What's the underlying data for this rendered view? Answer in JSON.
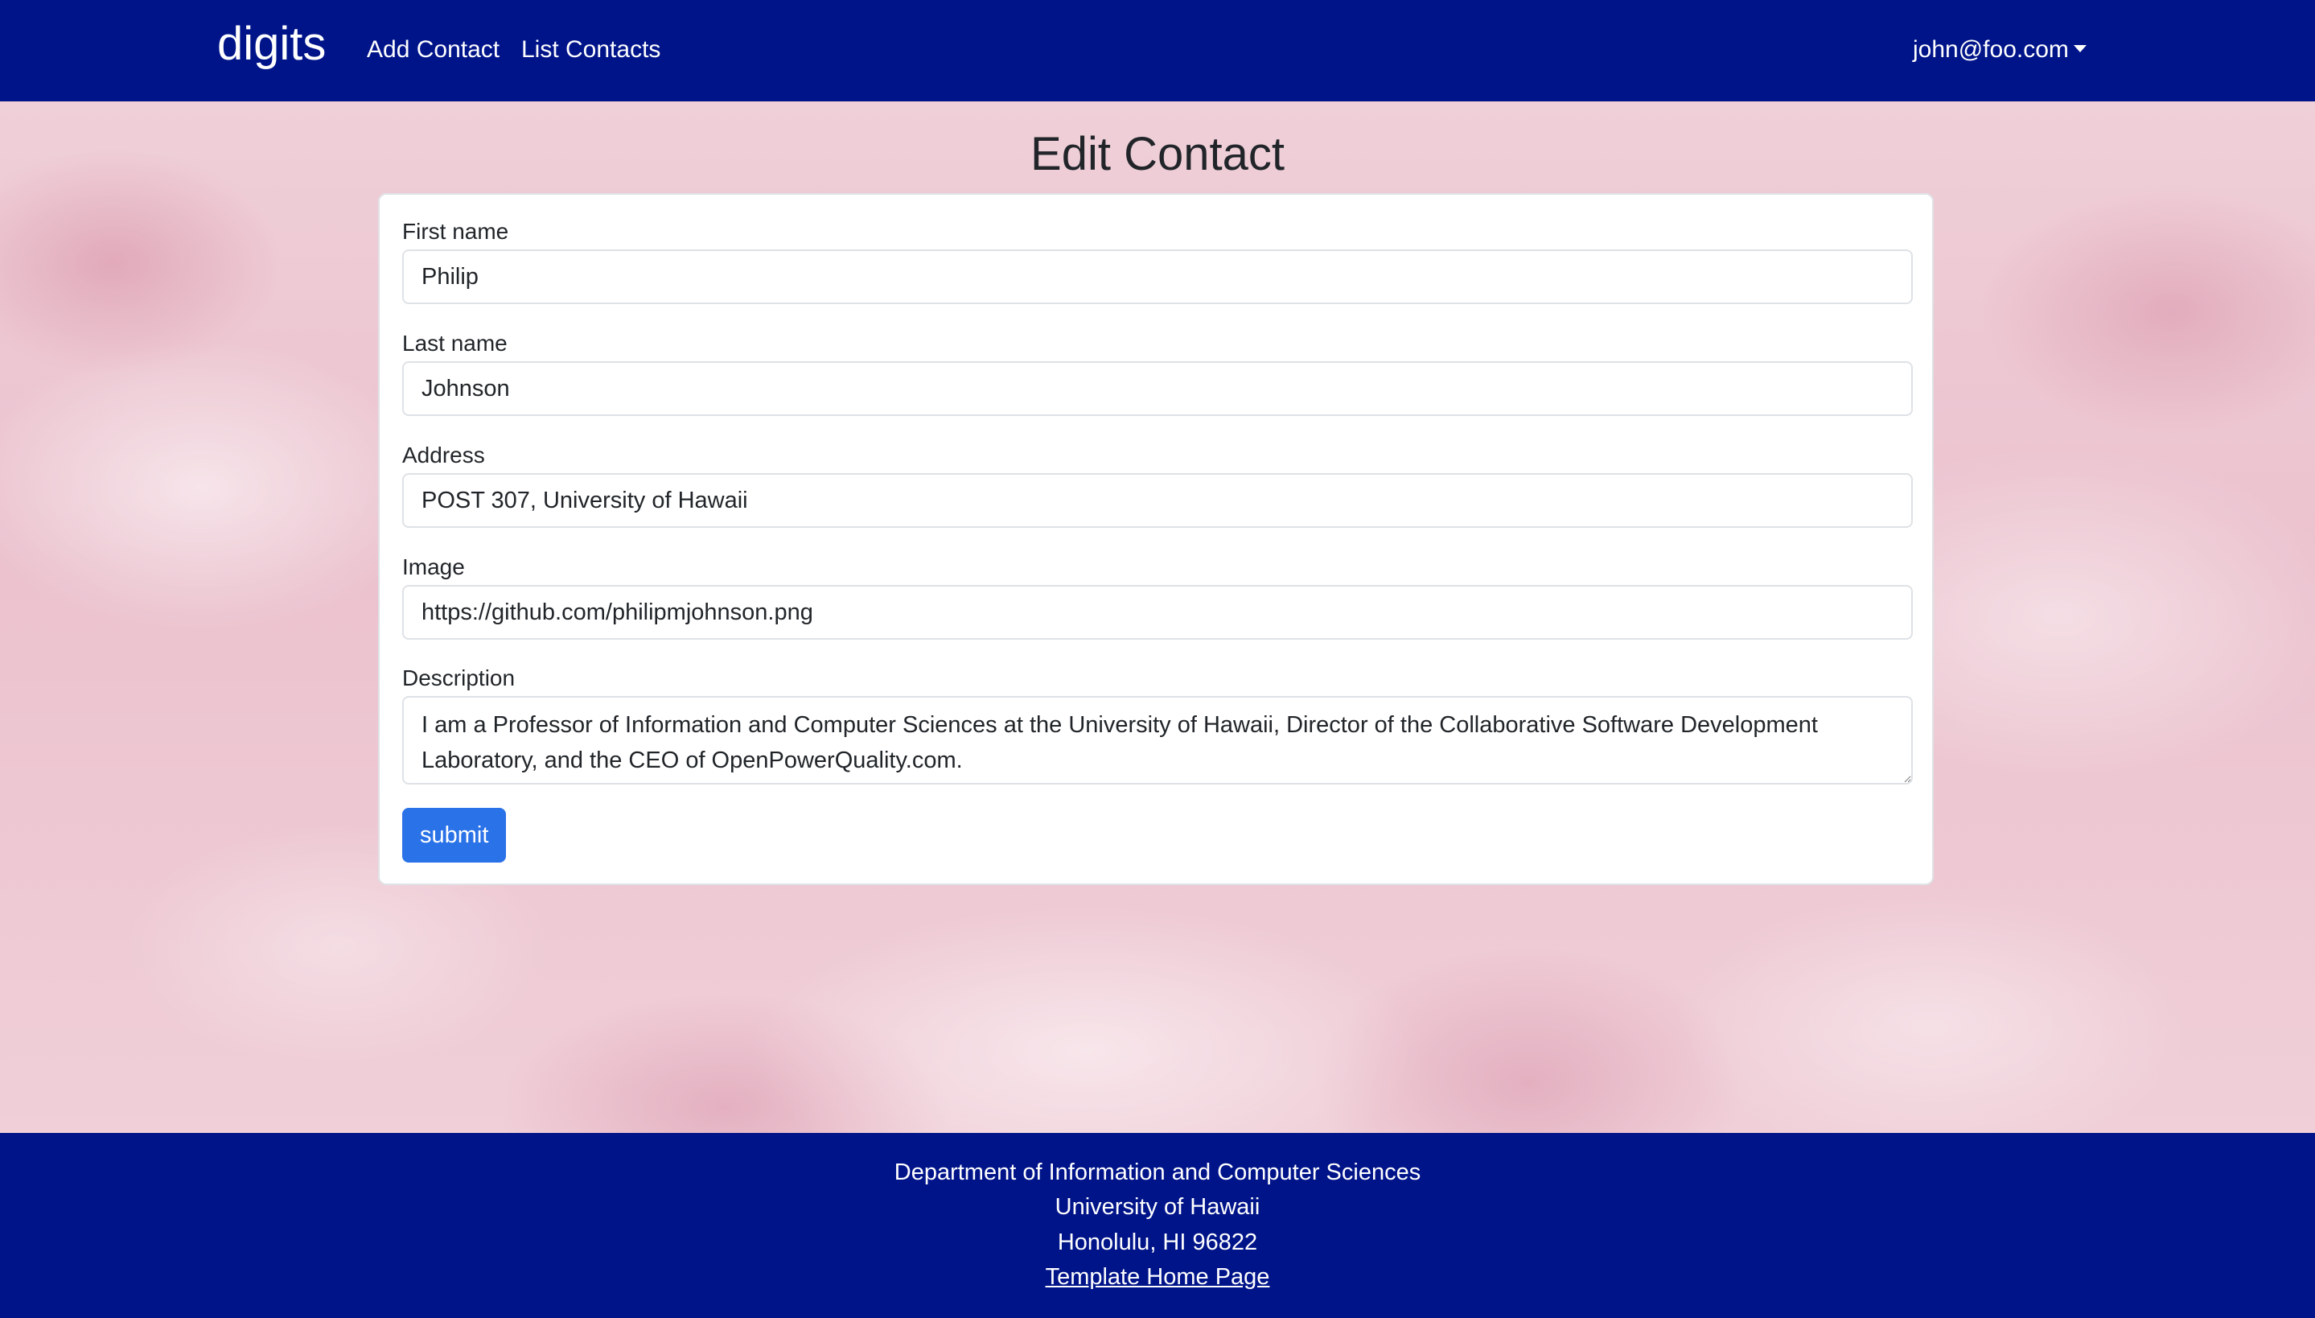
{
  "navbar": {
    "brand": "digits",
    "links": [
      {
        "label": "Add Contact"
      },
      {
        "label": "List Contacts"
      }
    ],
    "user": "john@foo.com"
  },
  "page": {
    "title": "Edit Contact"
  },
  "form": {
    "first_name": {
      "label": "First name",
      "value": "Philip"
    },
    "last_name": {
      "label": "Last name",
      "value": "Johnson"
    },
    "address": {
      "label": "Address",
      "value": "POST 307, University of Hawaii"
    },
    "image": {
      "label": "Image",
      "value": "https://github.com/philipmjohnson.png"
    },
    "description": {
      "label": "Description",
      "value": "I am a Professor of Information and Computer Sciences at the University of Hawaii, Director of the Collaborative Software Development Laboratory, and the CEO of OpenPowerQuality.com."
    },
    "submit_label": "submit"
  },
  "footer": {
    "lines": [
      "Department of Information and Computer Sciences",
      "University of Hawaii",
      "Honolulu, HI 96822"
    ],
    "link_label": "Template Home Page"
  },
  "colors": {
    "navbar_bg": "#001489",
    "primary_button": "#2a72e8",
    "background_tint": "#efc9d3"
  }
}
